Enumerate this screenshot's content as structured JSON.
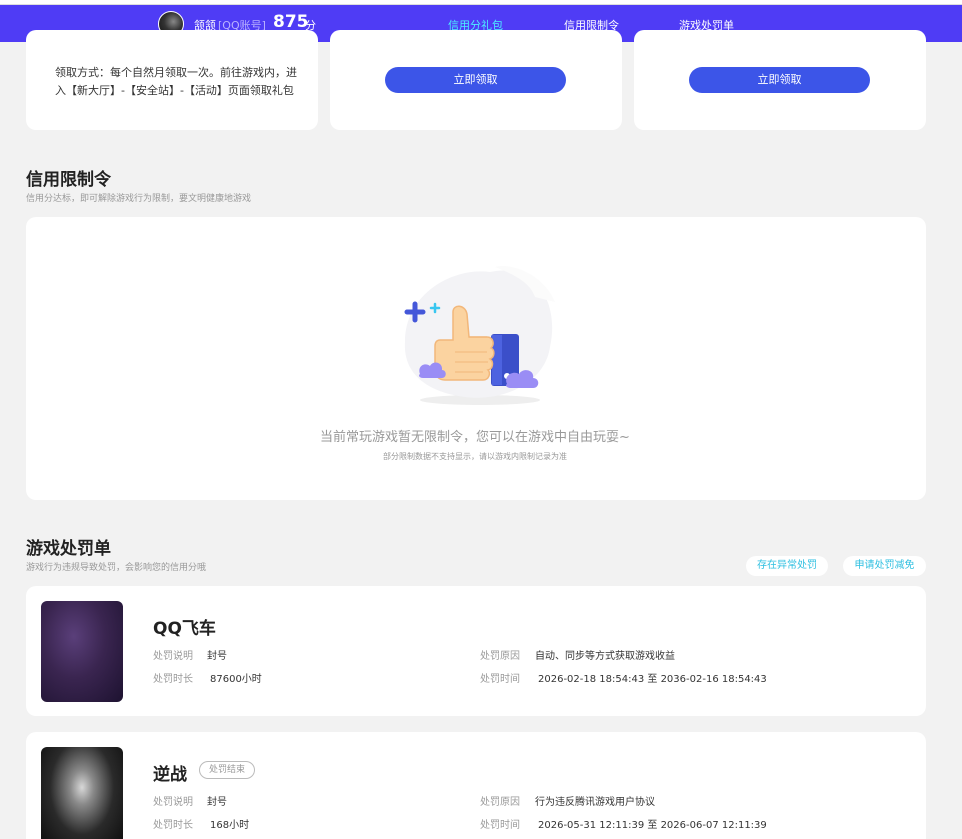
{
  "header": {
    "nickname": "颔颔",
    "account_type": "[QQ账号]",
    "score": "875",
    "score_unit": "分",
    "tabs": [
      {
        "label": "信用分礼包",
        "active": true
      },
      {
        "label": "信用限制令",
        "active": false
      },
      {
        "label": "游戏处罚单",
        "active": false
      }
    ]
  },
  "gift": {
    "claim_method": "领取方式：每个自然月领取一次。前往游戏内，进入【新大厅】-【安全站】-【活动】页面领取礼包",
    "claim_button_1": "立即领取",
    "claim_button_2": "立即领取"
  },
  "restriction": {
    "title": "信用限制令",
    "subtitle": "信用分达标，即可解除游戏行为限制，要文明健康地游戏",
    "empty_message": "当前常玩游戏暂无限制令，您可以在游戏中自由玩耍~",
    "empty_note": "部分限制数据不支持显示，请以游戏内限制记录为准"
  },
  "penalty": {
    "title": "游戏处罚单",
    "subtitle": "游戏行为违规导致处罚，会影响您的信用分哦",
    "abnormal_button": "存在异常处罚",
    "appeal_button": "申请处罚减免",
    "labels": {
      "desc": "处罚说明",
      "duration": "处罚时长",
      "reason": "处罚原因",
      "time": "处罚时间"
    },
    "items": [
      {
        "game": "QQ飞车",
        "badge": "",
        "desc": "封号",
        "duration": "87600小时",
        "reason": "自动、同步等方式获取游戏收益",
        "time": "2026-02-18 18:54:43 至 2036-02-16 18:54:43"
      },
      {
        "game": "逆战",
        "badge": "处罚结束",
        "desc": "封号",
        "duration": "168小时",
        "reason": "行为违反腾讯游戏用户协议",
        "time": "2026-05-31 12:11:39 至 2026-06-07 12:11:39"
      }
    ]
  },
  "colors": {
    "nav_bg": "#4f3cf5",
    "active_tab": "#4cf0ff",
    "button": "#3c55e8",
    "pill_text": "#2dbfe0"
  }
}
